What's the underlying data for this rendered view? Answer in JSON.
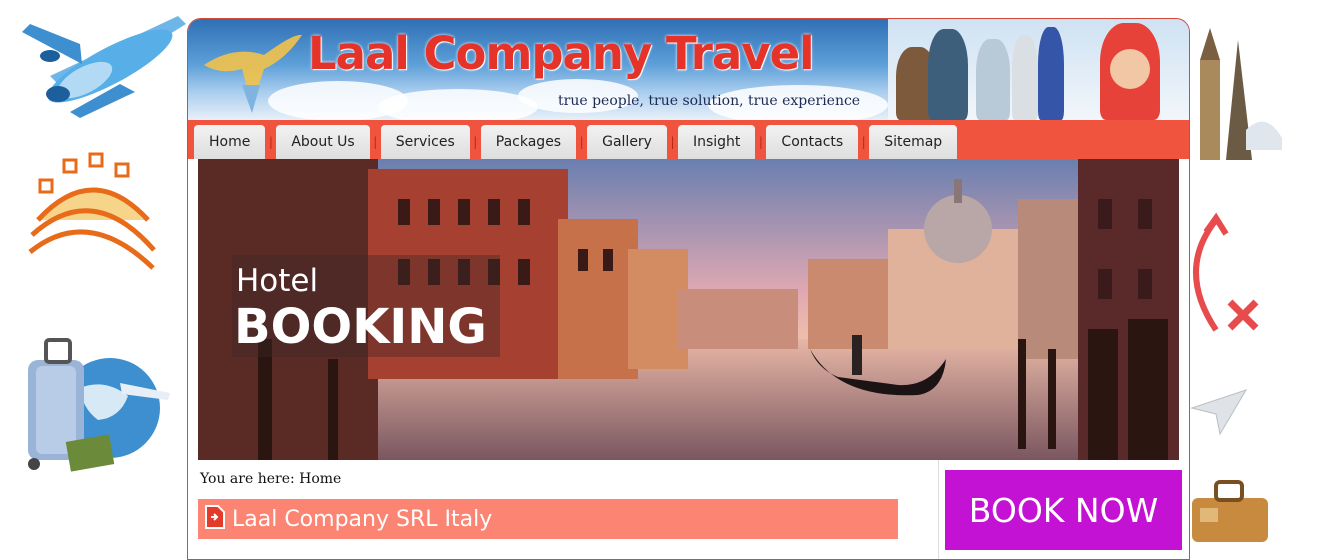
{
  "header": {
    "title": "Laal Company Travel",
    "tagline": "true people, true solution, true experience"
  },
  "nav": {
    "items": [
      {
        "label": "Home"
      },
      {
        "label": "About Us"
      },
      {
        "label": "Services"
      },
      {
        "label": "Packages"
      },
      {
        "label": "Gallery"
      },
      {
        "label": "Insight"
      },
      {
        "label": "Contacts"
      },
      {
        "label": "Sitemap"
      }
    ],
    "separator": "|"
  },
  "banner": {
    "line1": "Hotel",
    "line2": "BOOKING"
  },
  "breadcrumb": "You are here: Home",
  "section": {
    "title": "Laal Company SRL Italy"
  },
  "book_now": "BOOK NOW",
  "colors": {
    "nav_red": "#f0533e",
    "title_red": "#e5332a",
    "section_salmon": "#fb8572",
    "book_purple": "#c312d3"
  },
  "icons": [
    "airplane-icon",
    "sun-icon",
    "suitcase-globe-icon",
    "landmarks-icon",
    "arrow-x-icon",
    "paper-plane-icon",
    "luggage-icon",
    "eagle-logo-icon",
    "document-icon"
  ]
}
